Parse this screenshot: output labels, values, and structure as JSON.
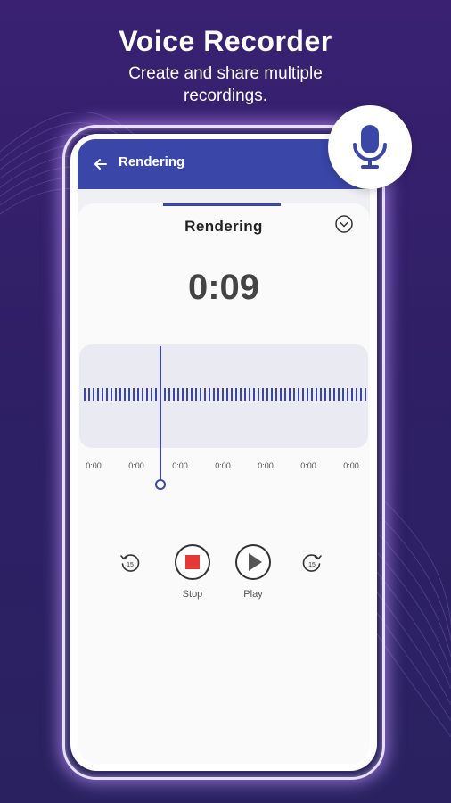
{
  "promo": {
    "title": "Voice Recorder",
    "subtitle": "Create and share multiple recordings."
  },
  "appbar": {
    "title": "Rendering",
    "back_icon": "arrow-left-icon",
    "color": "#3a46a8"
  },
  "recorder": {
    "title": "Rendering",
    "timer": "0:09",
    "collapse_icon": "chevron-down-circle-icon",
    "timeline_ticks": [
      "0:00",
      "0:00",
      "0:00",
      "0:00",
      "0:00",
      "0:00",
      "0:00"
    ]
  },
  "controls": {
    "rewind_icon": "rewind-15-icon",
    "rewind_value": "15",
    "stop_label": "Stop",
    "stop_icon": "stop-icon",
    "stop_color": "#e53935",
    "play_label": "Play",
    "play_icon": "play-icon",
    "forward_icon": "forward-15-icon",
    "forward_value": "15"
  },
  "badge": {
    "icon": "microphone-icon",
    "color": "#3a46a8"
  }
}
